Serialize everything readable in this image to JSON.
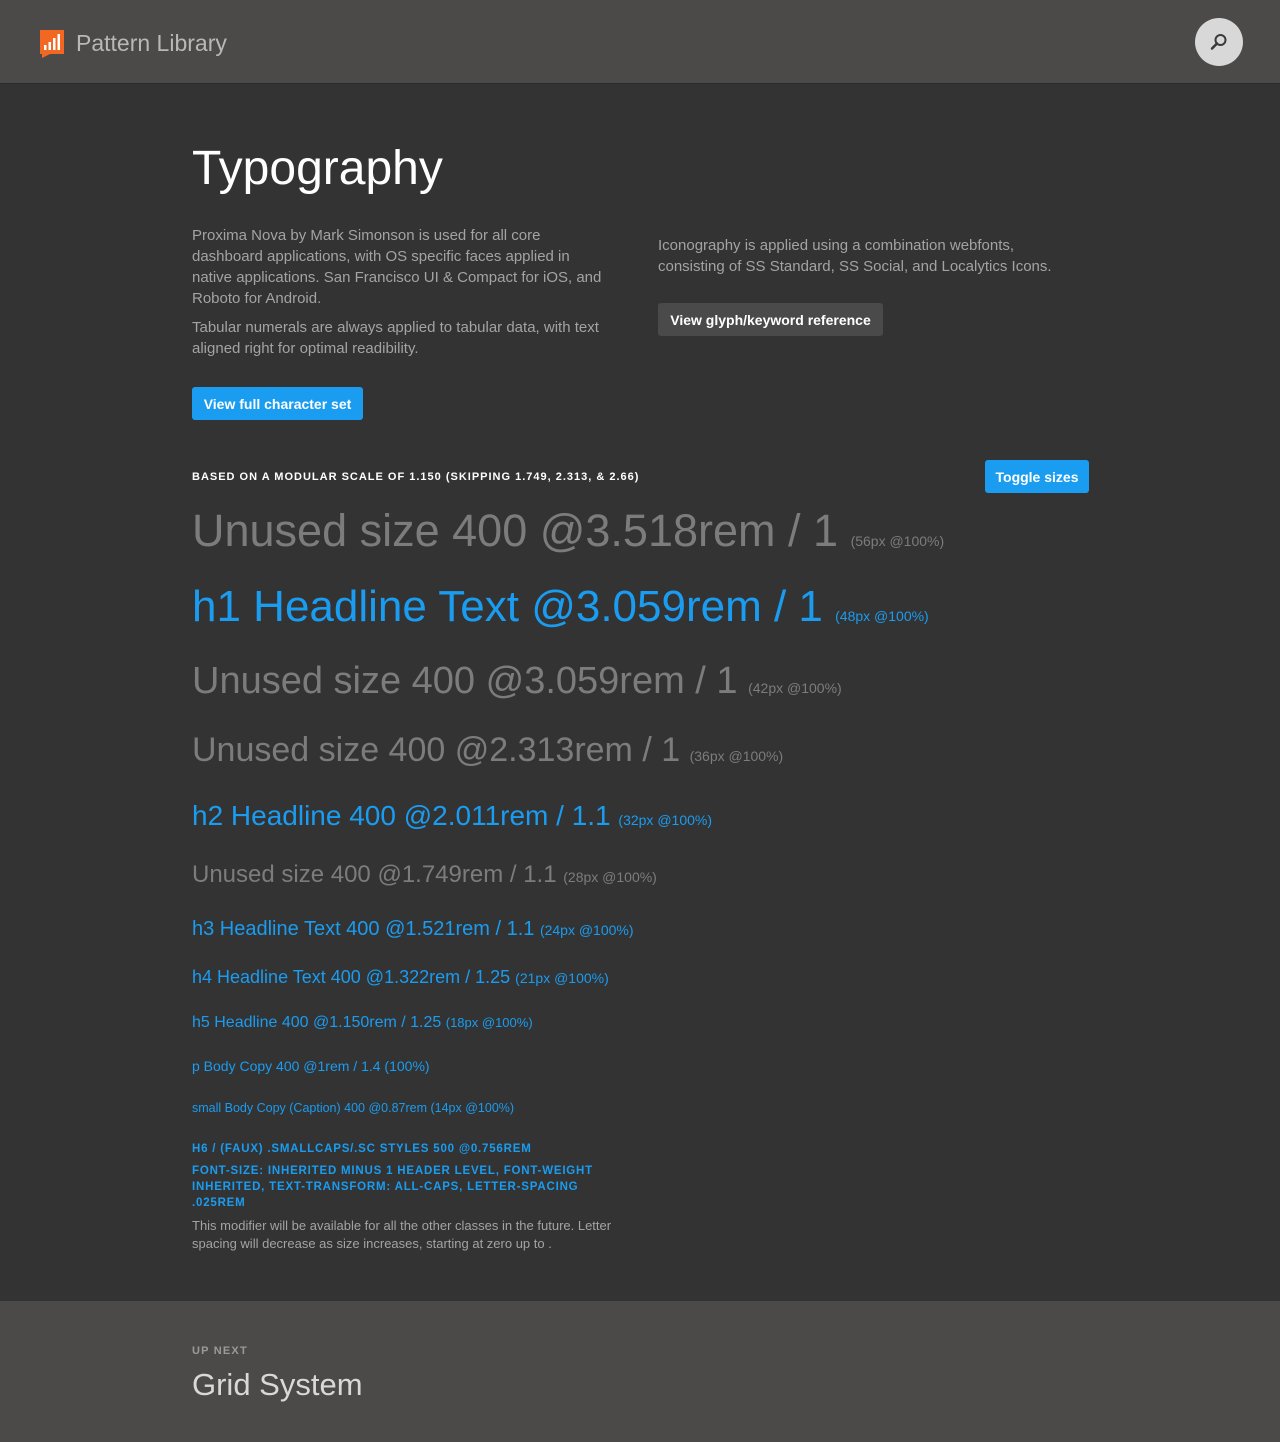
{
  "header": {
    "title": "Pattern Library"
  },
  "page": {
    "title": "Typography",
    "intro_left_1": "Proxima Nova by Mark Simonson is used for all core dashboard applications, with OS specific faces applied in native applications. San Francisco UI & Compact for iOS, and Roboto for Android.",
    "intro_left_2": "Tabular numerals are always applied to tabular data, with text aligned right for optimal readibility.",
    "char_set_button": "View full character set",
    "intro_right": "Iconography is applied using a combination webfonts, consisting of SS Standard, SS Social, and Localytics Icons.",
    "glyph_button": "View glyph/keyword reference"
  },
  "scale": {
    "heading": "BASED ON A MODULAR SCALE OF 1.150 (SKIPPING 1.749, 2.313, & 2.66)",
    "toggle_button": "Toggle sizes",
    "samples": [
      {
        "text": "Unused size 400 @3.518rem / 1",
        "note": "(56px @100%)"
      },
      {
        "text": "h1 Headline Text @3.059rem / 1",
        "note": "(48px @100%)"
      },
      {
        "text": "Unused size 400 @3.059rem / 1",
        "note": "(42px @100%)"
      },
      {
        "text": "Unused size 400 @2.313rem / 1",
        "note": "(36px @100%)"
      },
      {
        "text": "h2 Headline 400 @2.011rem / 1.1",
        "note": "(32px @100%)"
      },
      {
        "text": "Unused size 400 @1.749rem / 1.1",
        "note": "(28px @100%)"
      },
      {
        "text": "h3 Headline Text 400 @1.521rem / 1.1",
        "note": "(24px @100%)"
      },
      {
        "text": "h4 Headline Text 400 @1.322rem / 1.25",
        "note": "(21px @100%)"
      },
      {
        "text": "h5 Headline 400 @1.150rem / 1.25",
        "note": "(18px @100%)"
      },
      {
        "text": "p Body Copy 400 @1rem / 1.4 (100%)"
      },
      {
        "text": "small Body Copy (Caption) 400 @0.87rem (14px @100%)"
      }
    ],
    "sc_line_1": "H6 / (FAUX) .SMALLCAPS/.SC STYLES 500 @0.756REM",
    "sc_line_2": "FONT-SIZE: INHERITED MINUS 1 HEADER LEVEL, FONT-WEIGHT INHERITED, TEXT-TRANSFORM: ALL-CAPS, LETTER-SPACING .025REM",
    "modifier_note": "This modifier will be available for all the other classes in the future. Letter spacing will decrease as size increases, starting at zero up to ."
  },
  "footer": {
    "up_next_label": "UP NEXT",
    "up_next_title": "Grid System"
  },
  "colors": {
    "accent": "#1a9cf0",
    "logo": "#f26722",
    "background": "#333333",
    "topbar": "#4b4a48"
  }
}
